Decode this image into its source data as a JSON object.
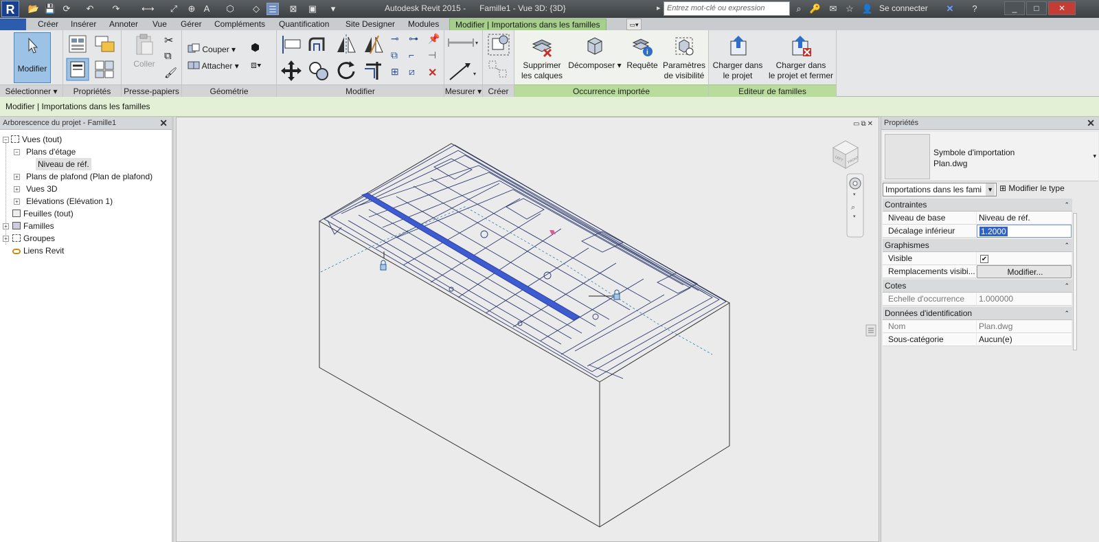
{
  "titlebar": {
    "app_title": "Autodesk Revit 2015 -      Famille1 - Vue 3D: {3D}",
    "search_placeholder": "Entrez mot-clé ou expression",
    "signin": "Se connecter",
    "logo": "R"
  },
  "tabs": [
    "Créer",
    "Insérer",
    "Annoter",
    "Vue",
    "Gérer",
    "Compléments",
    "Quantification",
    "Site Designer",
    "Modules",
    "Modifier | Importations dans les familles"
  ],
  "ribbon": {
    "modifier": "Modifier",
    "coller": "Coller",
    "couper": "Couper",
    "attacher": "Attacher",
    "supprimer_calques": [
      "Supprimer",
      "les calques"
    ],
    "decomposer": "Décomposer",
    "requete": "Requête",
    "parametres_visibilite": [
      "Paramètres",
      "de visibilité"
    ],
    "charger_projet": [
      "Charger dans",
      "le projet"
    ],
    "charger_fermer": [
      "Charger dans",
      "le projet et fermer"
    ],
    "panels": {
      "selectionner": "Sélectionner ▾",
      "proprietes": "Propriétés",
      "presse_papiers": "Presse-papiers",
      "geometrie": "Géométrie",
      "modifier": "Modifier",
      "mesurer": "Mesurer ▾",
      "creer": "Créer",
      "occurrence": "Occurrence importée",
      "editeur": "Editeur de familles"
    }
  },
  "optionsbar": {
    "context": "Modifier | Importations dans les familles"
  },
  "browser": {
    "title": "Arborescence du projet - Famille1",
    "items": [
      "Vues (tout)",
      "Plans d'étage",
      "Niveau de réf.",
      "Plans de plafond (Plan de plafond)",
      "Vues 3D",
      "Elévations (Elévation 1)",
      "Feuilles (tout)",
      "Familles",
      "Groupes",
      "Liens Revit"
    ]
  },
  "properties": {
    "title": "Propriétés",
    "type_line1": "Symbole d'importation",
    "type_line2": "Plan.dwg",
    "selector": "Importations dans les fami",
    "edit_type": "Modifier le type",
    "groups": {
      "contraintes": "Contraintes",
      "graphismes": "Graphismes",
      "cotes": "Cotes",
      "identification": "Données d'identification"
    },
    "rows": {
      "niveau_base": {
        "name": "Niveau de base",
        "value": "Niveau de réf."
      },
      "decalage": {
        "name": "Décalage inférieur",
        "value": "1.2000"
      },
      "visible": {
        "name": "Visible",
        "value": "✔"
      },
      "remplacements": {
        "name": "Remplacements visibi...",
        "value": "Modifier..."
      },
      "echelle": {
        "name": "Echelle d'occurrence",
        "value": "1.000000"
      },
      "nom": {
        "name": "Nom",
        "value": "Plan.dwg"
      },
      "sous_categorie": {
        "name": "Sous-catégorie",
        "value": "Aucun(e)"
      }
    }
  },
  "viewcube": {
    "face_left": "LEFT",
    "face_front": "FRONT"
  },
  "colors": {
    "accent_tab": "#a5cf8a",
    "selection_blue": "#3e5bd0",
    "lines": "#2d3a70"
  }
}
